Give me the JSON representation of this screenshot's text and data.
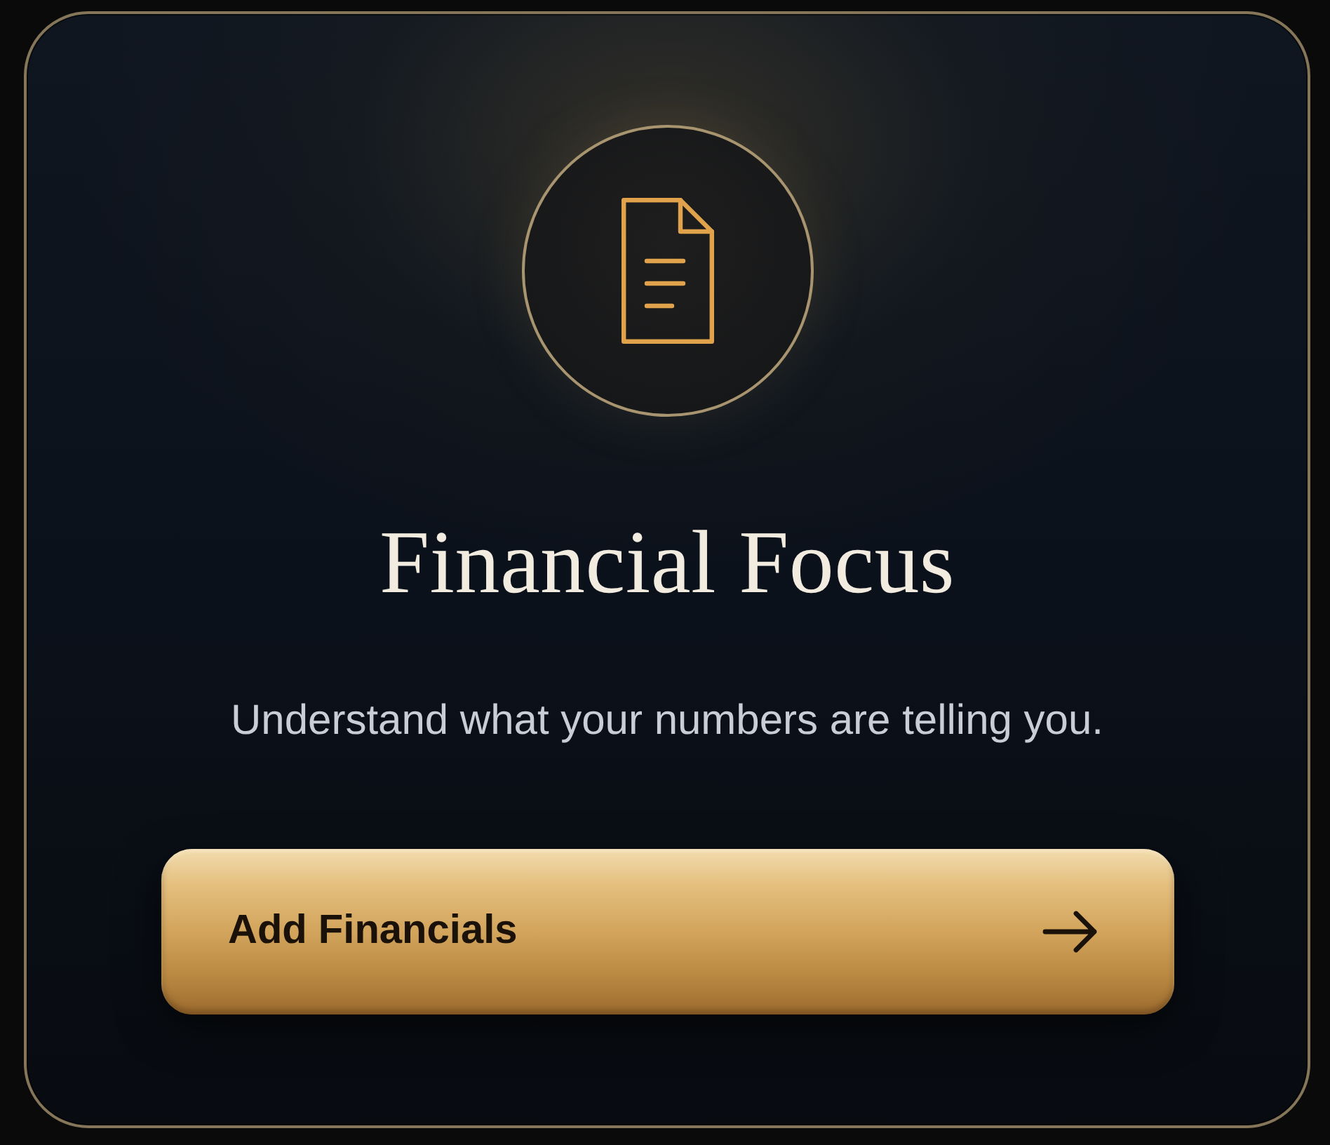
{
  "card": {
    "title": "Financial Focus",
    "subtitle": "Understand what your numbers are telling you.",
    "button": {
      "label": "Add Financials"
    }
  }
}
